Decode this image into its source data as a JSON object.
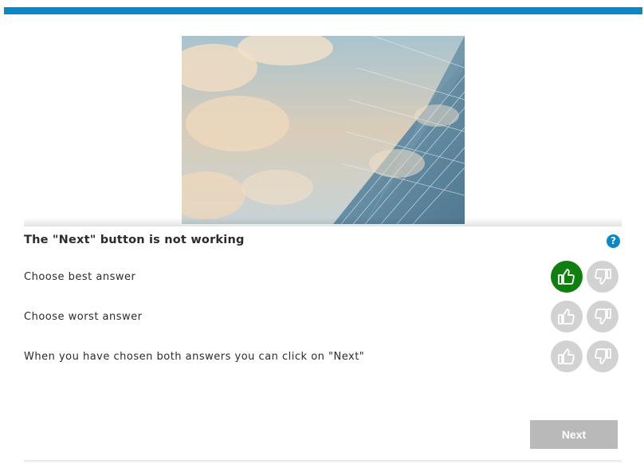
{
  "header": {
    "accent_color": "#0a87c8"
  },
  "question": {
    "title": "The \"Next\" button is not working",
    "help_label": "?"
  },
  "rows": [
    {
      "label": "Choose best answer",
      "selected": "up"
    },
    {
      "label": "Choose worst answer",
      "selected": "none"
    },
    {
      "label": "When you have chosen both answers you can click on \"Next\"",
      "selected": "none"
    }
  ],
  "colors": {
    "selected_green": "#0f7f10",
    "unselected_gray": "#d2d2d2",
    "next_disabled": "#b9b9b9"
  },
  "icons": {
    "up": "thumbs-up-icon",
    "down": "thumbs-down-icon"
  },
  "next_button": {
    "label": "Next",
    "enabled": false
  }
}
